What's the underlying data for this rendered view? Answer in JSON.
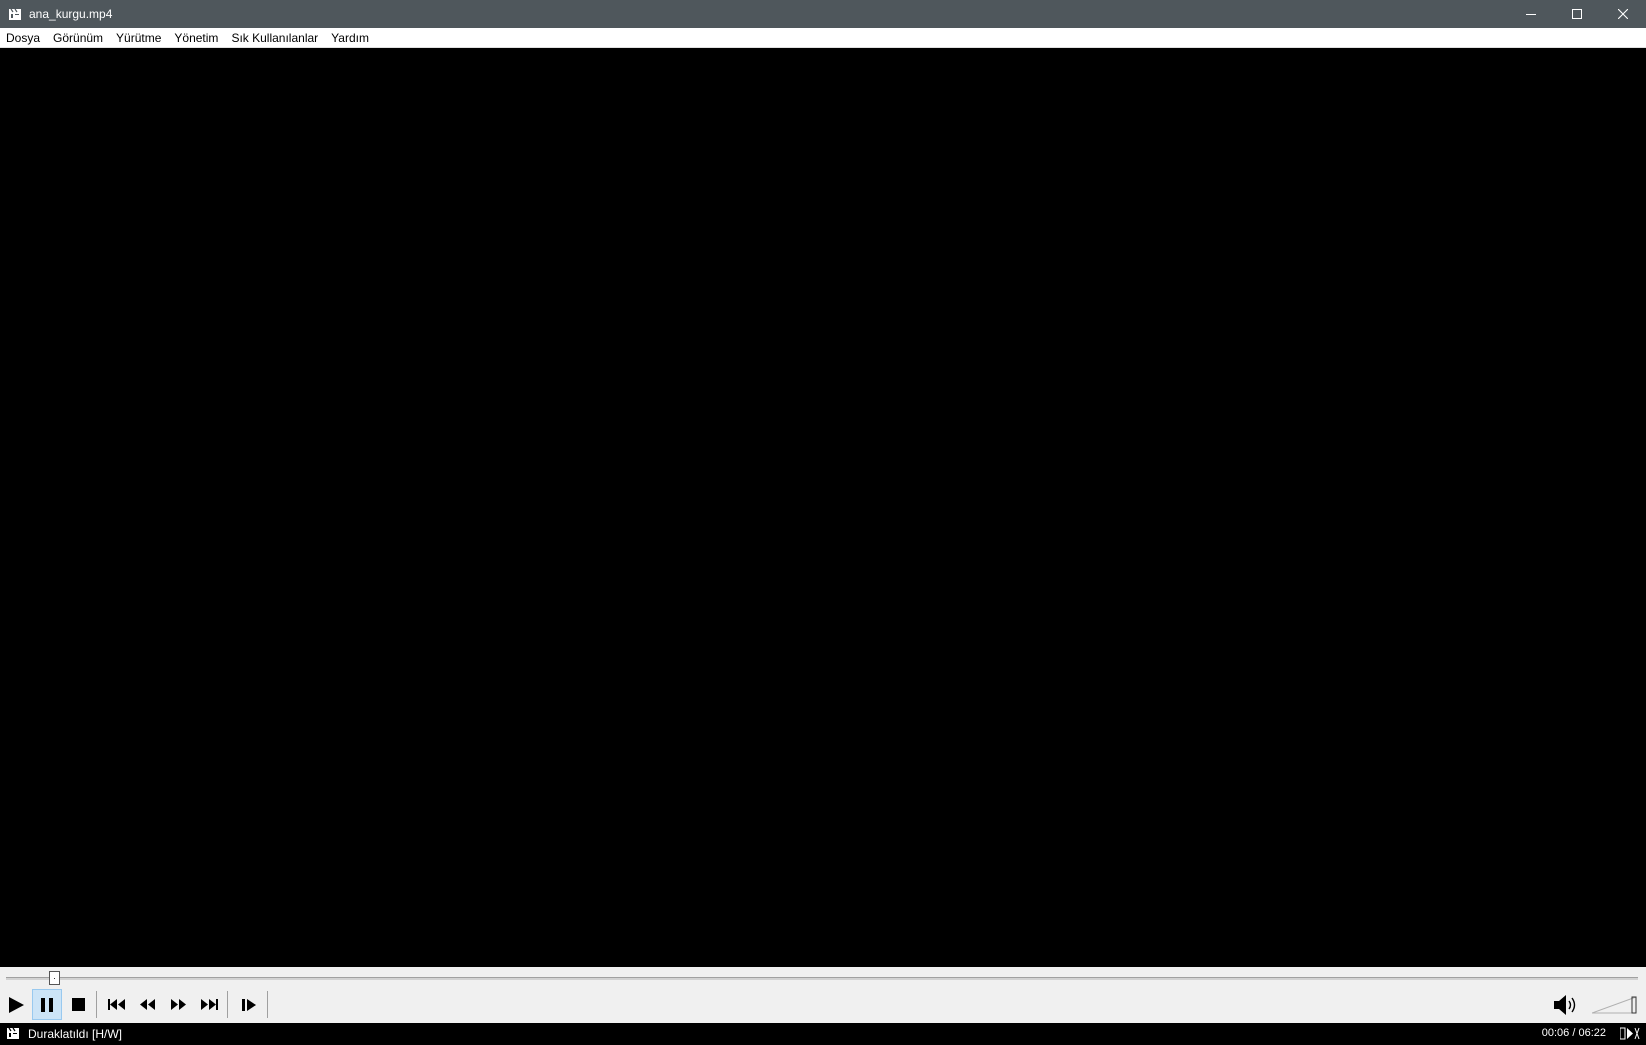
{
  "window": {
    "title": "ana_kurgu.mp4"
  },
  "menu": {
    "items": [
      {
        "label": "Dosya"
      },
      {
        "label": "Görünüm"
      },
      {
        "label": "Yürütme"
      },
      {
        "label": "Yönetim"
      },
      {
        "label": "Sık Kullanılanlar"
      },
      {
        "label": "Yardım"
      }
    ]
  },
  "playback": {
    "position": "00:06",
    "duration": "06:22",
    "time_display": "00:06 / 06:22",
    "progress_fraction": 0.016,
    "volume_fraction": 1.0
  },
  "status": {
    "text": "Duraklatıldı [H/W]"
  },
  "icons": {
    "app": "clapperboard-icon",
    "play": "play-icon",
    "pause": "pause-icon",
    "stop": "stop-icon",
    "previous": "skip-previous-icon",
    "rewind": "rewind-icon",
    "forward": "fast-forward-icon",
    "next": "skip-next-icon",
    "frame_step": "frame-step-icon",
    "volume": "speaker-icon"
  },
  "colors": {
    "titlebar": "#4f575c",
    "active_button": "#cce4f7"
  }
}
